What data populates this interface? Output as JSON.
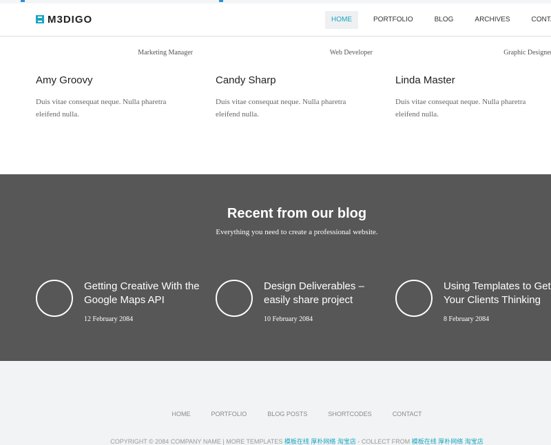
{
  "header": {
    "logo_text": "M3DIGO",
    "nav": [
      {
        "label": "HOME",
        "active": true
      },
      {
        "label": "PORTFOLIO",
        "active": false
      },
      {
        "label": "BLOG",
        "active": false
      },
      {
        "label": "ARCHIVES",
        "active": false
      },
      {
        "label": "CONTACT",
        "active": false
      }
    ]
  },
  "team": {
    "members": [
      {
        "role": "Marketing Manager",
        "name": "Amy Groovy",
        "desc": "Duis vitae consequat neque. Nulla pharetra eleifend nulla."
      },
      {
        "role": "Web Developer",
        "name": "Candy Sharp",
        "desc": "Duis vitae consequat neque. Nulla pharetra eleifend nulla."
      },
      {
        "role": "Graphic Designer",
        "name": "Linda Master",
        "desc": "Duis vitae consequat neque. Nulla pharetra eleifend nulla."
      }
    ]
  },
  "blog": {
    "title": "Recent from our blog",
    "subtitle": "Everything you need to create a professional website.",
    "posts": [
      {
        "title": "Getting Creative With the Google Maps API",
        "date": "12 February 2084"
      },
      {
        "title": "Design Deliverables – easily share project",
        "date": "10 February 2084"
      },
      {
        "title": "Using Templates to Get Your Clients Thinking",
        "date": "8 February 2084"
      }
    ]
  },
  "footer": {
    "links": [
      "HOME",
      "PORTFOLIO",
      "BLOG POSTS",
      "SHORTCODES",
      "CONTACT"
    ],
    "copyright_prefix": "COPYRIGHT © 2084 COMPANY NAME | MORE TEMPLATES ",
    "copyright_link1": "模板在线 厚朴网络 淘宝店",
    "copyright_mid": " - COLLECT FROM ",
    "copyright_link2": "模板在线 厚朴网络 淘宝店"
  },
  "colors": {
    "accent": "#18a7c2",
    "blog_bg": "#575757",
    "footer_bg": "#f2f3f4"
  }
}
